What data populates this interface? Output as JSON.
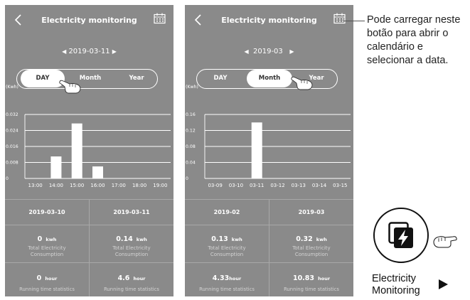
{
  "screen1": {
    "title": "Electricity monitoring",
    "date": "2019-03-11",
    "tabs": [
      "DAY",
      "Month",
      "Year"
    ],
    "active_tab": "DAY",
    "chart_data": {
      "type": "bar",
      "ylabel": "(Kwh)",
      "categories": [
        "13:00",
        "14:00",
        "15:00",
        "16:00",
        "17:00",
        "18:00",
        "19:00"
      ],
      "values": [
        0,
        0.011,
        0.0275,
        0.006,
        0,
        0,
        0
      ],
      "ylim": [
        0,
        0.032
      ],
      "yticks": [
        "0",
        "0.008",
        "0.016",
        "0.024",
        "0.032"
      ],
      "grid": true
    },
    "stats": {
      "col1_header": "2019-03-10",
      "col2_header": "2019-03-11",
      "consumption1": "0",
      "consumption2": "0.14",
      "consumption_unit": "kwh",
      "consumption_label": "Total Electricity Consumption",
      "hours1": "0",
      "hours2": "4.6",
      "hours_unit": "hour",
      "hours_label": "Running time statistics"
    }
  },
  "screen2": {
    "title": "Electricity monitoring",
    "date": "2019-03",
    "tabs": [
      "DAY",
      "Month",
      "Year"
    ],
    "active_tab": "Month",
    "chart_data": {
      "type": "bar",
      "ylabel": "(Kwh)",
      "categories": [
        "03-09",
        "03-10",
        "03-11",
        "03-12",
        "03-13",
        "03-14",
        "03-15"
      ],
      "values": [
        0,
        0,
        0.14,
        0,
        0,
        0,
        0
      ],
      "ylim": [
        0,
        0.16
      ],
      "yticks": [
        "0",
        "0.04",
        "0.08",
        "0.12",
        "0.16"
      ],
      "grid": true
    },
    "stats": {
      "col1_header": "2019-02",
      "col2_header": "2019-03",
      "consumption1": "0.13",
      "consumption2": "0.32",
      "consumption_unit": "kwh",
      "consumption_label": "Total Electricity Consumption",
      "hours1": "4.33",
      "hours2": "10.83",
      "hours_unit": "hour",
      "hours_label": "Running time statistics"
    }
  },
  "callout_text": "Pode carregar neste botão para abrir o calendário e selecionar a data.",
  "electricity_label_line1": "Electricity",
  "electricity_label_line2": "Monitoring",
  "colors": {
    "screen_bg": "#8a8a8a",
    "grid": "#ffffff",
    "bar": "#ffffff",
    "divider": "#a8a8a8",
    "text": "#ffffff"
  }
}
